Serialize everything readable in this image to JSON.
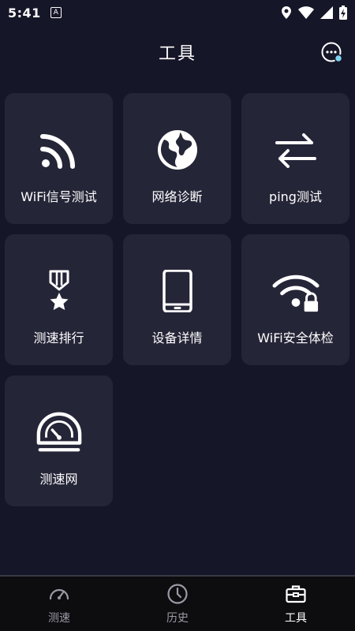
{
  "status_bar": {
    "time": "5:41",
    "badge": "A"
  },
  "header": {
    "title": "工具"
  },
  "tools": [
    {
      "label": "WiFi信号测试",
      "icon": "wifi-signal-icon"
    },
    {
      "label": "网络诊断",
      "icon": "globe-icon"
    },
    {
      "label": "ping测试",
      "icon": "swap-arrows-icon"
    },
    {
      "label": "测速排行",
      "icon": "medal-icon"
    },
    {
      "label": "设备详情",
      "icon": "phone-icon"
    },
    {
      "label": "WiFi安全体检",
      "icon": "wifi-lock-icon"
    },
    {
      "label": "测速网",
      "icon": "speedometer-icon"
    }
  ],
  "bottom_nav": [
    {
      "label": "测速",
      "icon": "gauge-icon",
      "active": false
    },
    {
      "label": "历史",
      "icon": "clock-icon",
      "active": false
    },
    {
      "label": "工具",
      "icon": "toolbox-icon",
      "active": true
    }
  ],
  "colors": {
    "background": "#161629",
    "tile": "#252538",
    "nav_background": "#0d0d10",
    "accent_dot": "#7fd3f0"
  }
}
